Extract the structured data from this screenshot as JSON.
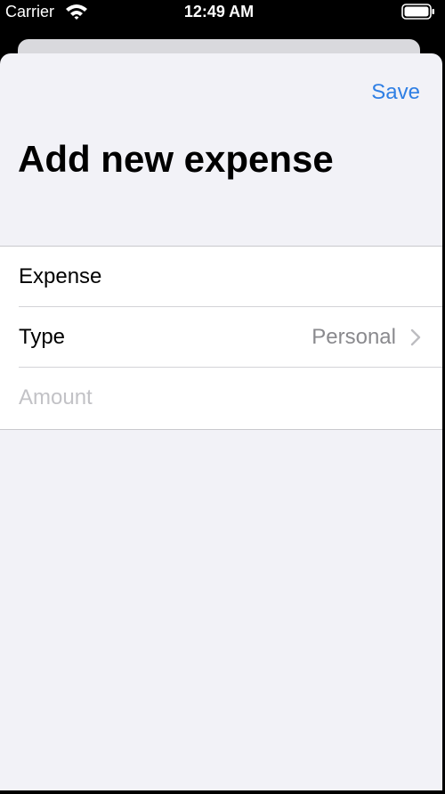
{
  "status_bar": {
    "carrier": "Carrier",
    "time": "12:49 AM",
    "icons": [
      "wifi-icon",
      "battery-icon"
    ]
  },
  "nav": {
    "save_label": "Save"
  },
  "page": {
    "title": "Add new expense"
  },
  "form": {
    "expense_label": "Expense",
    "type_label": "Type",
    "type_value": "Personal",
    "amount_placeholder": "Amount",
    "amount_value": ""
  },
  "colors": {
    "accent": "#2f7fe4",
    "background": "#f2f2f7",
    "secondary_text": "#8a8a8e",
    "placeholder_text": "#c2c2c6"
  }
}
